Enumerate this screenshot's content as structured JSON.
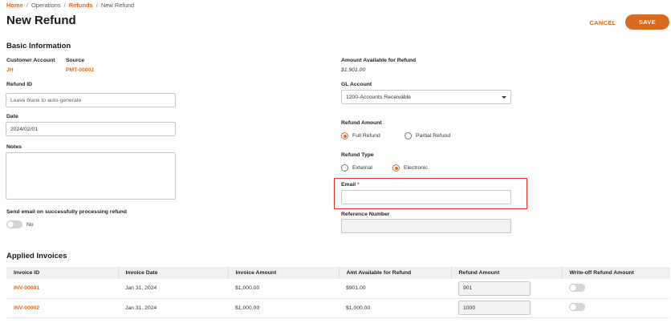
{
  "breadcrumb": {
    "home": "Home",
    "sep": "/",
    "operations": "Operations",
    "refunds": "Refunds",
    "current": "New Refund"
  },
  "page_title": "New Refund",
  "actions": {
    "cancel": "CANCEL",
    "save": "SAVE"
  },
  "basic_info": {
    "title": "Basic Information",
    "customer_account_label": "Customer Account",
    "customer_account_value": "JH",
    "source_label": "Source",
    "source_value": "PMT-00002",
    "refund_id_label": "Refund ID",
    "refund_id_placeholder": "Leave blank to auto-generate",
    "date_label": "Date",
    "date_value": "2024/02/01",
    "notes_label": "Notes",
    "send_email_label": "Send email on successfully processing refund",
    "send_email_toggle_text": "No",
    "amount_available_label": "Amount Available for Refund",
    "amount_available_value": "$1,901.00",
    "gl_account_label": "GL Account",
    "gl_account_value": "1200-Accounts Receivable",
    "refund_amount_label": "Refund Amount",
    "refund_amount_options": [
      "Full Refund",
      "Partial Refund"
    ],
    "refund_amount_selected": "Full Refund",
    "refund_type_label": "Refund Type",
    "refund_type_options": [
      "External",
      "Electronic"
    ],
    "refund_type_selected": "Electronic",
    "email_label": "Email",
    "email_required_mark": "*",
    "reference_number_label": "Reference Number"
  },
  "applied_invoices": {
    "title": "Applied Invoices",
    "columns": [
      "Invoice ID",
      "Invoice Date",
      "Invoice Amount",
      "Amt Available for Refund",
      "Refund Amount",
      "Write-off Refund Amount"
    ],
    "rows": [
      {
        "invoice_id": "INV-00001",
        "invoice_date": "Jan 31, 2024",
        "invoice_amount": "$1,000.00",
        "amt_available": "$901.00",
        "refund_amount": "901",
        "write_off": false
      },
      {
        "invoice_id": "INV-00002",
        "invoice_date": "Jan 31, 2024",
        "invoice_amount": "$1,000.00",
        "amt_available": "$1,000.00",
        "refund_amount": "1000",
        "write_off": false
      }
    ]
  },
  "colors": {
    "accent": "#d96a1f",
    "highlight": "#e0392b"
  }
}
